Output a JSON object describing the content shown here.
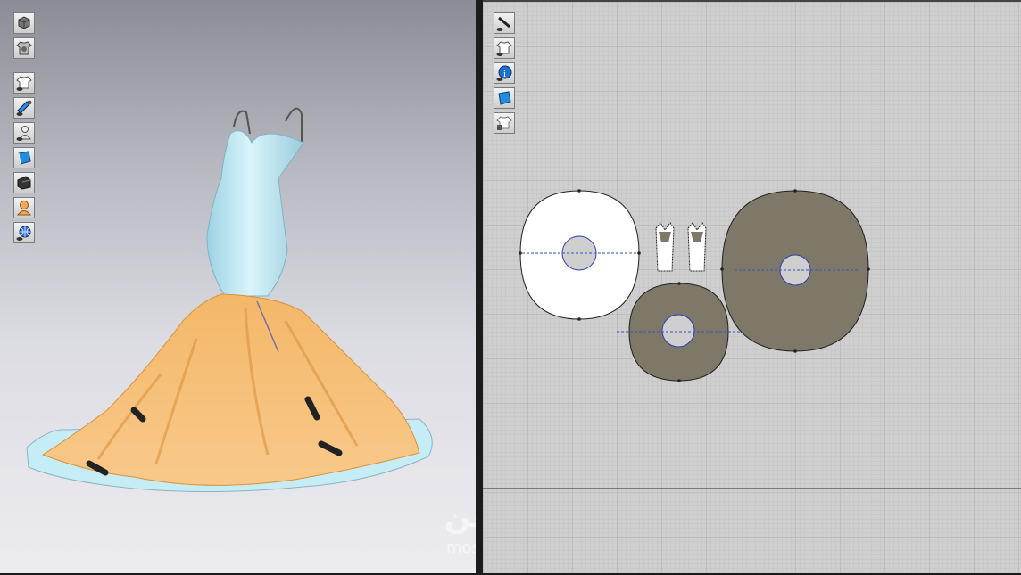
{
  "app": {
    "panes": [
      "3d-garment-window",
      "2d-pattern-window"
    ]
  },
  "toolbar_3d": {
    "buttons": [
      {
        "name": "box-mode-icon"
      },
      {
        "name": "shirt-gear-icon"
      },
      {
        "name": "show-garment-icon"
      },
      {
        "name": "show-pins-icon"
      },
      {
        "name": "show-avatar-icon"
      },
      {
        "name": "texture-mode-icon"
      },
      {
        "name": "solid-view-icon"
      },
      {
        "name": "avatar-color-icon"
      },
      {
        "name": "environment-globe-icon"
      }
    ]
  },
  "toolbar_2d": {
    "buttons": [
      {
        "name": "show-baseline-icon"
      },
      {
        "name": "show-pattern-icon"
      },
      {
        "name": "pattern-info-icon"
      },
      {
        "name": "texture-2d-icon"
      },
      {
        "name": "lock-pattern-icon"
      }
    ]
  },
  "colors": {
    "dress_bodice": "#c9eef6",
    "dress_skirt": "#f6b56a",
    "pattern_front": "#ffffff",
    "pattern_fabric": "#7d7868",
    "seam_line": "#3a4fc4"
  },
  "watermark": {
    "brand": "مُتقن",
    "sub": "mos"
  }
}
